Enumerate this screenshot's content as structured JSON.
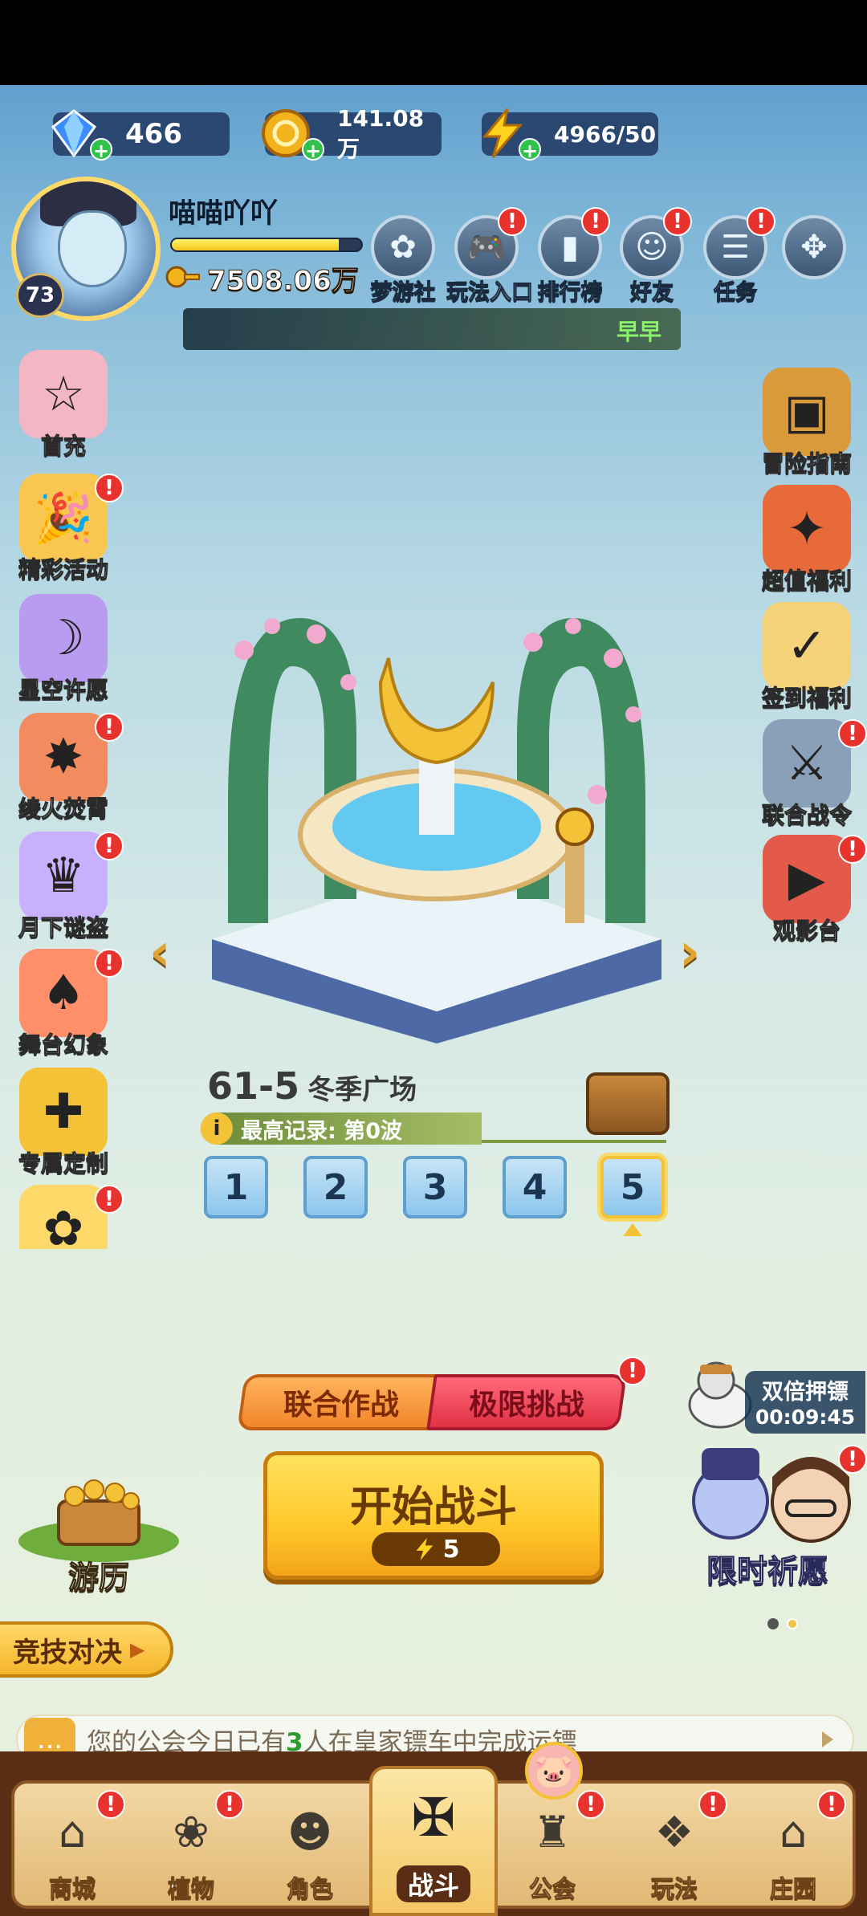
{
  "currency": {
    "diamonds": "466",
    "gold": "141.08万",
    "energy": "4966/50"
  },
  "player": {
    "name": "喵喵吖吖",
    "level": "73",
    "xp_fraction": 0.88,
    "coins": "7508.06万",
    "nameplate": "早早"
  },
  "top_menu": [
    {
      "label": "梦游社",
      "icon": "dream-club-icon",
      "badge": false
    },
    {
      "label": "玩法入口",
      "icon": "gamepad-icon",
      "badge": true
    },
    {
      "label": "排行榜",
      "icon": "ranking-icon",
      "badge": true
    },
    {
      "label": "好友",
      "icon": "friends-icon",
      "badge": true
    },
    {
      "label": "任务",
      "icon": "tasks-icon",
      "badge": true
    },
    {
      "label": "",
      "icon": "more-icon",
      "badge": false
    }
  ],
  "left_side": [
    {
      "label": "首充",
      "icon": "first-recharge-icon",
      "badge": false
    },
    {
      "label": "精彩活动",
      "icon": "events-icon",
      "badge": true
    },
    {
      "label": "星空许愿",
      "icon": "star-wish-icon",
      "badge": false
    },
    {
      "label": "绫火焚霄",
      "icon": "fire-event-icon",
      "badge": true
    },
    {
      "label": "月下谜盗",
      "icon": "moon-thief-icon",
      "badge": true
    },
    {
      "label": "舞台幻象",
      "icon": "stage-illusion-icon",
      "badge": true
    },
    {
      "label": "专属定制",
      "icon": "custom-gift-icon",
      "badge": false
    },
    {
      "label": "",
      "icon": "flower-icon",
      "badge": true
    }
  ],
  "right_side": [
    {
      "label": "冒险指南",
      "icon": "guide-book-icon",
      "badge": false
    },
    {
      "label": "超值福利",
      "icon": "value-welfare-icon",
      "badge": false
    },
    {
      "label": "签到福利",
      "icon": "checkin-calendar-icon",
      "badge": false
    },
    {
      "label": "联合战令",
      "icon": "battle-pass-icon",
      "badge": true
    },
    {
      "label": "观影台",
      "icon": "cinema-icon",
      "badge": true
    }
  ],
  "stage": {
    "number": "61-5",
    "name": "冬季广场",
    "record": "最高记录: 第0波",
    "waves": [
      "1",
      "2",
      "3",
      "4",
      "5"
    ],
    "selected_wave": "5"
  },
  "modes": {
    "coop": "联合作战",
    "limit": "极限挑战"
  },
  "start": {
    "label": "开始战斗",
    "cost": "5"
  },
  "journey": "游历",
  "escort": {
    "title": "双倍押镖",
    "timer": "00:09:45"
  },
  "limited_wish": "限时祈愿",
  "arena": "竞技对决",
  "ticker": {
    "prefix": "您的公会今日已有",
    "count": "3",
    "suffix": "人在皇家镖车中完成运镖"
  },
  "bottom_nav": [
    {
      "label": "商城",
      "icon": "shop-icon",
      "badge": true
    },
    {
      "label": "植物",
      "icon": "plant-icon",
      "badge": true
    },
    {
      "label": "角色",
      "icon": "character-icon",
      "badge": false
    },
    {
      "label": "战斗",
      "icon": "windmill-battle-icon",
      "badge": false
    },
    {
      "label": "公会",
      "icon": "guild-icon",
      "badge": true
    },
    {
      "label": "玩法",
      "icon": "modes-icon",
      "badge": true
    },
    {
      "label": "庄园",
      "icon": "manor-icon",
      "badge": true
    }
  ],
  "colors": {
    "accent_gold": "#f4c236",
    "badge_red": "#e8322e",
    "record_green": "#2c9a2c"
  }
}
